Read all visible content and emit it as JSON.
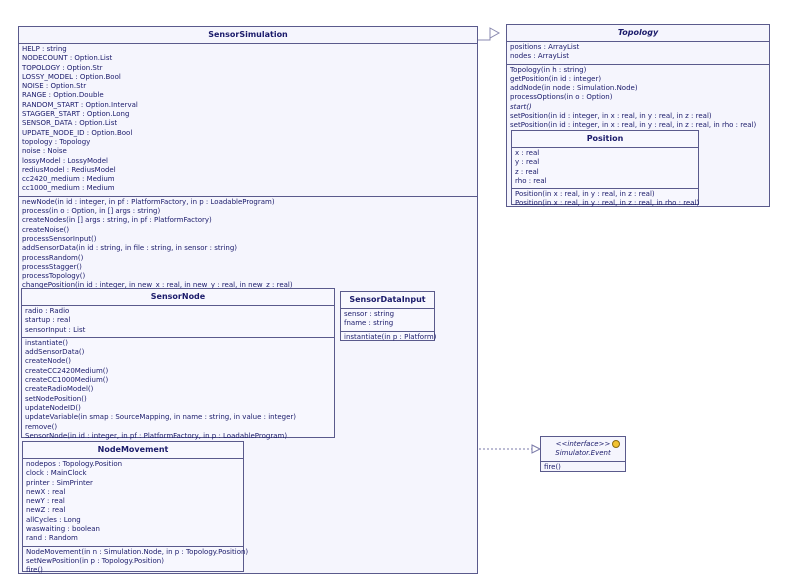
{
  "colors": {
    "border": "#5a5a8c",
    "fill": "#f5f5fd",
    "text": "#1a1a6a",
    "interface_icon": "#f2c230"
  },
  "sensor_simulation": {
    "name": "SensorSimulation",
    "attributes": [
      "HELP : string",
      "NODECOUNT : Option.List",
      "TOPOLOGY : Option.Str",
      "LOSSY_MODEL : Option.Bool",
      "NOISE : Option.Str",
      "RANGE : Option.Double",
      "RANDOM_START : Option.Interval",
      "STAGGER_START : Option.Long",
      "SENSOR_DATA : Option.List",
      "UPDATE_NODE_ID : Option.Bool",
      "topology : Topology",
      "noise : Noise",
      "lossyModel : LossyModel",
      "rediusModel : RediusModel",
      "cc2420_medium : Medium",
      "cc1000_medium : Medium"
    ],
    "operations": [
      "newNode(in id : integer, in pf : PlatformFactory, in p : LoadableProgram)",
      "process(in o : Option, in [] args : string)",
      "createNodes(in [] args : string, in pf : PlatformFactory)",
      "createNoise()",
      "processSensorInput()",
      "addSensorData(in id : string, in file : string, in sensor : string)",
      "processRandom()",
      "processStagger()",
      "processTopology()",
      "changePosition(in id : integer, in new_x : real, in new_y : real, in new_z : real)"
    ]
  },
  "sensor_node": {
    "name": "SensorNode",
    "attributes": [
      "radio : Radio",
      "startup : real",
      "sensorInput : List"
    ],
    "operations": [
      "instantiate()",
      "addSensorData()",
      "createNode()",
      "createCC2420Medium()",
      "createCC1000Medium()",
      "createRadioModel()",
      "setNodePosition()",
      "updateNodeID()",
      "updateVariable(in smap : SourceMapping, in name : string, in value : integer)",
      "remove()",
      "SensorNode(in id : integer, in pf : PlatformFactory, in p : LoadableProgram)"
    ]
  },
  "sensor_data_input": {
    "name": "SensorDataInput",
    "attributes": [
      "sensor : string",
      "fname : string"
    ],
    "operations": [
      "instantiate(in p : Platform)"
    ]
  },
  "node_movement": {
    "name": "NodeMovement",
    "attributes": [
      "nodepos : Topology.Position",
      "clock : MainClock",
      "printer : SimPrinter",
      "newX : real",
      "newY : real",
      "newZ : real",
      "allCycles : Long",
      "waswaiting : boolean",
      "rand : Random"
    ],
    "operations": [
      "NodeMovement(in n : Simulation.Node, in p : Topology.Position)",
      "setNewPosition(in p : Topology.Position)",
      "fire()"
    ]
  },
  "topology": {
    "name": "Topology",
    "attributes": [
      "positions : ArrayList",
      "nodes : ArrayList"
    ],
    "operations": [
      "Topology(in h : string)",
      "getPosition(in id : integer)",
      "addNode(in node : Simulation.Node)",
      "processOptions(in o : Option)",
      "start()",
      "setPosition(in id : integer, in x : real, in y : real, in z : real)",
      "setPosition(in id : integer, in x : real, in y : real, in z : real, in rho : real)"
    ]
  },
  "position": {
    "name": "Position",
    "attributes": [
      "x : real",
      "y : real",
      "z : real",
      "rho : real"
    ],
    "operations": [
      "Position(in x : real, in y : real, in z : real)",
      "Position(in x : real, in y : real, in z : real, in rho : real)"
    ]
  },
  "simulator_event": {
    "stereotype": "<<interface>>",
    "name": "Simulator.Event",
    "operations": [
      "fire()"
    ]
  }
}
